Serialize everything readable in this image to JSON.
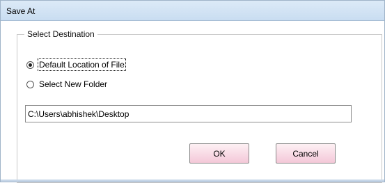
{
  "window": {
    "title": "Save At"
  },
  "group": {
    "legend": "Select Destination",
    "options": [
      {
        "label": "Default Location of File",
        "checked": true
      },
      {
        "label": "Select New Folder",
        "checked": false
      }
    ],
    "path_value": "C:\\Users\\abhishek\\Desktop"
  },
  "buttons": {
    "ok": "OK",
    "cancel": "Cancel"
  },
  "colors": {
    "titlebar": "#c9ddf1",
    "button_fill": "#f4c8d8"
  }
}
